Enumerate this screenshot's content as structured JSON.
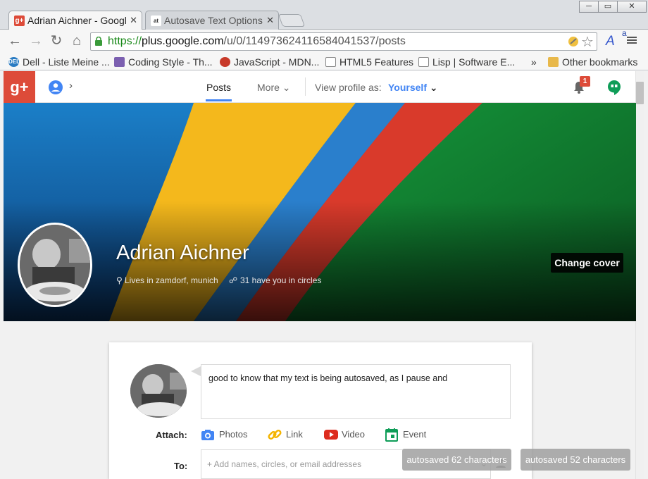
{
  "browser": {
    "tabs": [
      {
        "title": "Adrian Aichner - Googl",
        "favicon": "g+"
      },
      {
        "title": "Autosave Text Options",
        "favicon": "at"
      }
    ],
    "window_controls": {
      "minimize": "─",
      "maximize": "▭",
      "close": "✕"
    },
    "url": {
      "scheme": "https://",
      "host": "plus.google.com",
      "path": "/u/0/114973624116584041537/posts"
    },
    "bookmarks": [
      {
        "label": "Dell - Liste Meine ...",
        "icon": "dell-icon"
      },
      {
        "label": "Coding Style - Th...",
        "icon": "page-icon"
      },
      {
        "label": "JavaScript - MDN...",
        "icon": "mdn-icon"
      },
      {
        "label": "HTML5 Features",
        "icon": "page-icon"
      },
      {
        "label": "Lisp | Software E...",
        "icon": "page-icon"
      }
    ],
    "overflow": "»",
    "other_bookmarks": "Other bookmarks"
  },
  "gplus": {
    "logo": "g+",
    "nav": {
      "posts": "Posts",
      "more": "More",
      "view_profile_as": "View profile as:",
      "yourself": "Yourself"
    },
    "notification_count": "1"
  },
  "profile": {
    "name": "Adrian Aichner",
    "lives": "Lives in zamdorf, munich",
    "circles": "31 have you in circles",
    "change_cover": "Change cover"
  },
  "share": {
    "compose_text": "good to know that my text is being autosaved, as I pause and",
    "attach_label": "Attach:",
    "attach": {
      "photos": "Photos",
      "link": "Link",
      "video": "Video",
      "event": "Event"
    },
    "to_label": "To:",
    "to_placeholder": "+ Add names, circles, or email addresses"
  },
  "toasts": [
    "autosaved 62 characters",
    "autosaved 52 characters"
  ],
  "colors": {
    "gplus_red": "#dd4b39",
    "link_blue": "#4285f4",
    "hangouts_green": "#0f9d58"
  }
}
